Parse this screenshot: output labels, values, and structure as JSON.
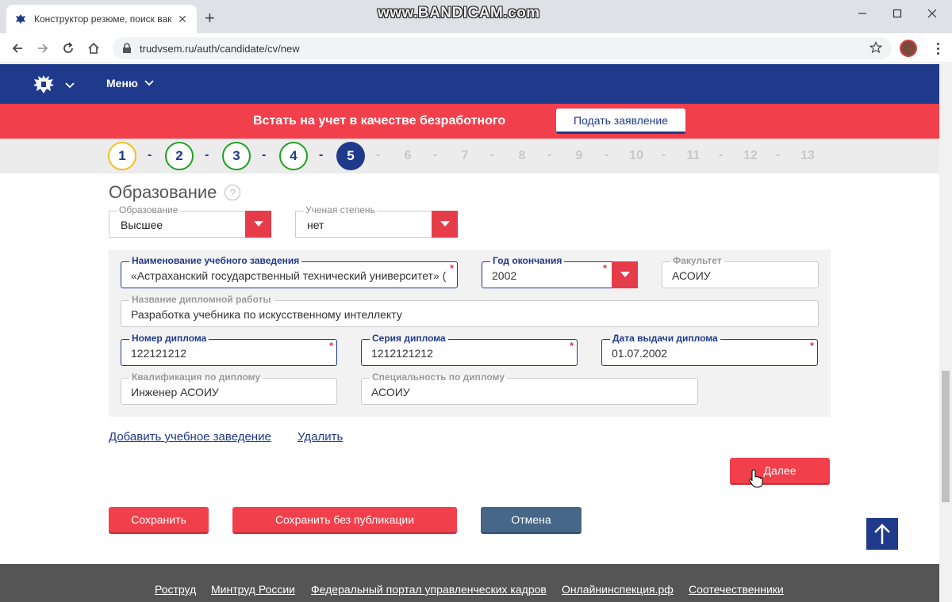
{
  "browser": {
    "tab_title": "Конструктор резюме, поиск вак",
    "new_tab_symbol": "+",
    "url": "trudvsem.ru/auth/candidate/cv/new",
    "watermark": "www.BANDICAM.com",
    "win_minimize": "—",
    "win_maximize": "☐",
    "win_close": "✕"
  },
  "header": {
    "menu_label": "Меню"
  },
  "banner": {
    "text": "Встать на учет в качестве безработного",
    "button": "Подать заявление"
  },
  "steps": {
    "items": [
      {
        "n": "1",
        "state": "partial"
      },
      {
        "n": "2",
        "state": "done"
      },
      {
        "n": "3",
        "state": "done"
      },
      {
        "n": "4",
        "state": "done"
      },
      {
        "n": "5",
        "state": "current"
      },
      {
        "n": "6",
        "state": "todo"
      },
      {
        "n": "7",
        "state": "todo"
      },
      {
        "n": "8",
        "state": "todo"
      },
      {
        "n": "9",
        "state": "todo"
      },
      {
        "n": "10",
        "state": "todo"
      },
      {
        "n": "11",
        "state": "todo"
      },
      {
        "n": "12",
        "state": "todo"
      },
      {
        "n": "13",
        "state": "todo"
      }
    ],
    "separator": "-",
    "colors": {
      "partial": "#f0c020",
      "done": "#20a020",
      "current": "#1f3a8a",
      "todo": "#c8c8c8"
    }
  },
  "section": {
    "title": "Образование",
    "help": "?"
  },
  "education_level": {
    "label": "Образование",
    "value": "Высшее"
  },
  "degree": {
    "label": "Ученая степень",
    "value": "нет"
  },
  "institution": {
    "name": {
      "label": "Наименование учебного заведения",
      "value": "«Астраханский государственный технический университет» (ФГБОУ ВО «АГТУ»)"
    },
    "grad_year": {
      "label": "Год окончания",
      "value": "2002"
    },
    "faculty": {
      "label": "Факультет",
      "value": "АСОИУ"
    },
    "thesis": {
      "label": "Название дипломной работы",
      "value": "Разработка учебника по искусственному интеллекту"
    },
    "diploma_number": {
      "label": "Номер диплома",
      "value": "122121212"
    },
    "diploma_series": {
      "label": "Серия диплома",
      "value": "1212121212"
    },
    "diploma_date": {
      "label": "Дата выдачи диплома",
      "value": "01.07.2002"
    },
    "qualification": {
      "label": "Квалификация по диплому",
      "value": "Инженер АСОИУ"
    },
    "specialty": {
      "label": "Специальность по диплому",
      "value": "АСОИУ"
    },
    "required_mark": "*"
  },
  "actions": {
    "add_institution": "Добавить учебное заведение",
    "delete": "Удалить",
    "next": "Далее",
    "save": "Сохранить",
    "save_no_publish": "Сохранить без публикации",
    "cancel": "Отмена"
  },
  "footer": {
    "links": [
      "Роструд",
      "Минтруд России",
      "Федеральный портал управленческих кадров",
      "Онлайнинспекция.рф",
      "Соотечественники"
    ]
  },
  "icons": {
    "back": "back-arrow-icon",
    "forward": "forward-arrow-icon",
    "reload": "reload-icon",
    "home": "home-icon",
    "lock": "lock-icon",
    "star": "bookmark-star-icon",
    "to_top": "arrow-up-icon"
  }
}
